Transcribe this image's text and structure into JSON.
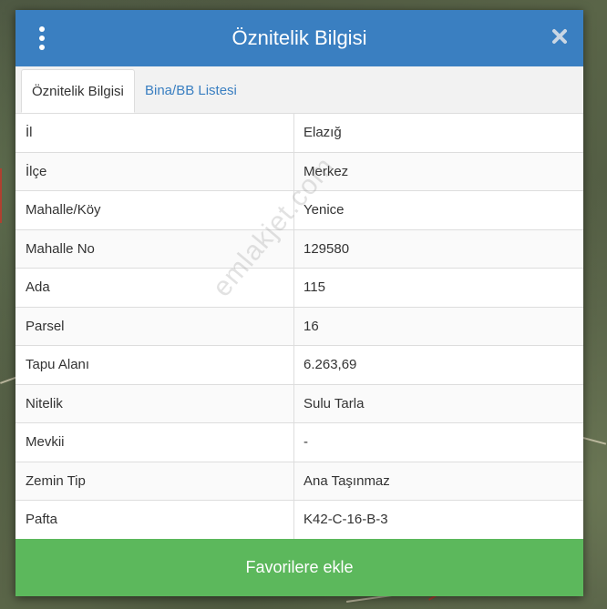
{
  "dialog": {
    "title": "Öznitelik Bilgisi",
    "close_icon": "close-icon",
    "menu_icon": "vertical-dots-icon"
  },
  "tabs": [
    {
      "label": "Öznitelik Bilgisi",
      "active": true
    },
    {
      "label": "Bina/BB Listesi",
      "active": false
    }
  ],
  "rows": [
    {
      "key": "İl",
      "value": "Elazığ"
    },
    {
      "key": "İlçe",
      "value": "Merkez"
    },
    {
      "key": "Mahalle/Köy",
      "value": "Yenice"
    },
    {
      "key": "Mahalle No",
      "value": "129580"
    },
    {
      "key": "Ada",
      "value": "115"
    },
    {
      "key": "Parsel",
      "value": "16"
    },
    {
      "key": "Tapu Alanı",
      "value": "6.263,69"
    },
    {
      "key": "Nitelik",
      "value": "Sulu Tarla"
    },
    {
      "key": "Mevkii",
      "value": "-"
    },
    {
      "key": "Zemin Tip",
      "value": "Ana Taşınmaz"
    },
    {
      "key": "Pafta",
      "value": "K42-C-16-B-3"
    }
  ],
  "watermark": "emlakjet.com",
  "favorite_button": "Favorilere ekle",
  "colors": {
    "header": "#3a7fc1",
    "tab_link": "#3a7fc1",
    "favorite_button": "#5cb85c"
  }
}
